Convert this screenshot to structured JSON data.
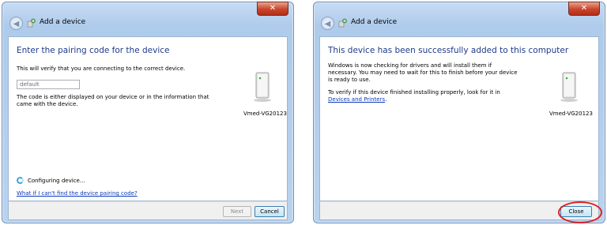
{
  "left_dialog": {
    "title": "Add a device",
    "heading": "Enter the pairing code for the device",
    "intro": "This will verify that you are connecting to the correct device.",
    "code_value": "default",
    "help_line1": "The code is either displayed on your device or in the information that",
    "help_line2": "came with the device.",
    "device_name": "Vmed-VG20123",
    "status": "Configuring device...",
    "help_link": "What if I can't find the device pairing code?",
    "next_label": "Next",
    "cancel_label": "Cancel"
  },
  "right_dialog": {
    "title": "Add a device",
    "heading": "This device has been successfully added to this computer",
    "line1": "Windows is now checking for drivers and will install them if",
    "line2": "necessary. You may need to wait for this to finish before your device",
    "line3": "is ready to use.",
    "verify_line": "To verify if this device finished installing properly, look for it in",
    "link": "Devices and Printers",
    "link_suffix": ".",
    "device_name": "Vmed-VG20123",
    "close_label": "Close"
  },
  "colors": {
    "heading": "#1e3b8b",
    "link": "#0b39b9",
    "highlight": "#e02020"
  }
}
